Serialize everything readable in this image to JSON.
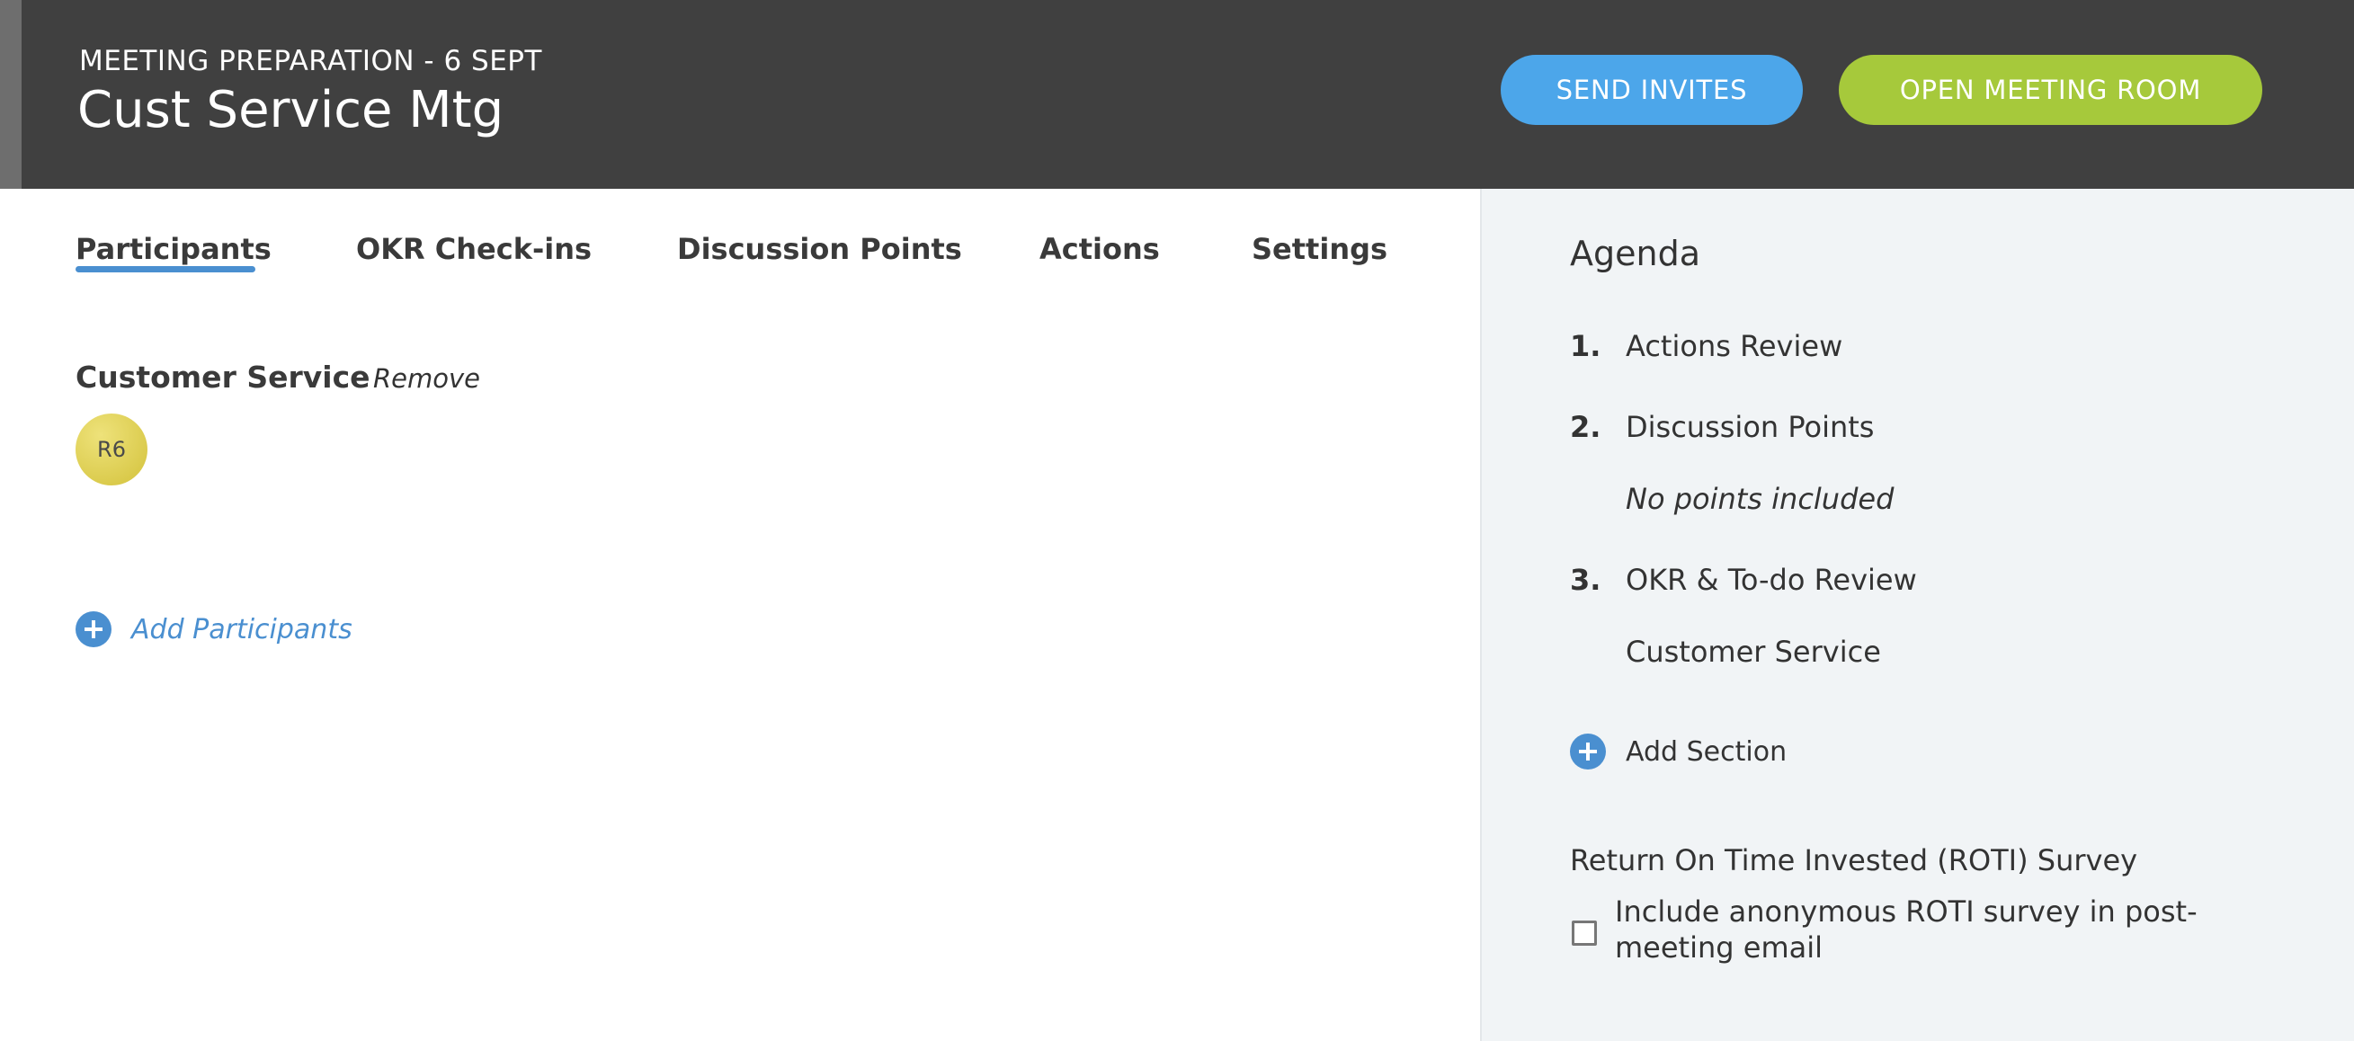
{
  "header": {
    "subtitle": "MEETING PREPARATION - 6 SEPT",
    "title": "Cust Service Mtg",
    "send_invites_label": "SEND INVITES",
    "open_room_label": "OPEN MEETING ROOM",
    "colors": {
      "background": "#404040",
      "send_invites": "#4ca6ea",
      "open_room": "#a6c93b"
    }
  },
  "tabs": [
    {
      "label": "Participants",
      "active": true
    },
    {
      "label": "OKR Check-ins",
      "active": false
    },
    {
      "label": "Discussion Points",
      "active": false
    },
    {
      "label": "Actions",
      "active": false
    },
    {
      "label": "Settings",
      "active": false
    }
  ],
  "participants": {
    "group_label": "Customer Service",
    "remove_label": "Remove",
    "avatar_initials": "R6",
    "add_label": "Add Participants",
    "add_icon": "plus-circle-icon"
  },
  "agenda": {
    "title": "Agenda",
    "items": [
      {
        "number": "1.",
        "label": "Actions Review"
      },
      {
        "number": "2.",
        "label": "Discussion Points",
        "note": "No points included"
      },
      {
        "number": "3.",
        "label": "OKR & To-do Review",
        "note": "Customer Service"
      }
    ],
    "add_section_label": "Add Section",
    "roti_heading": "Return On Time Invested (ROTI) Survey",
    "roti_checkbox_label": "Include anonymous ROTI survey in post-meeting email",
    "roti_checked": false
  },
  "accent_color": "#4a8fd0"
}
